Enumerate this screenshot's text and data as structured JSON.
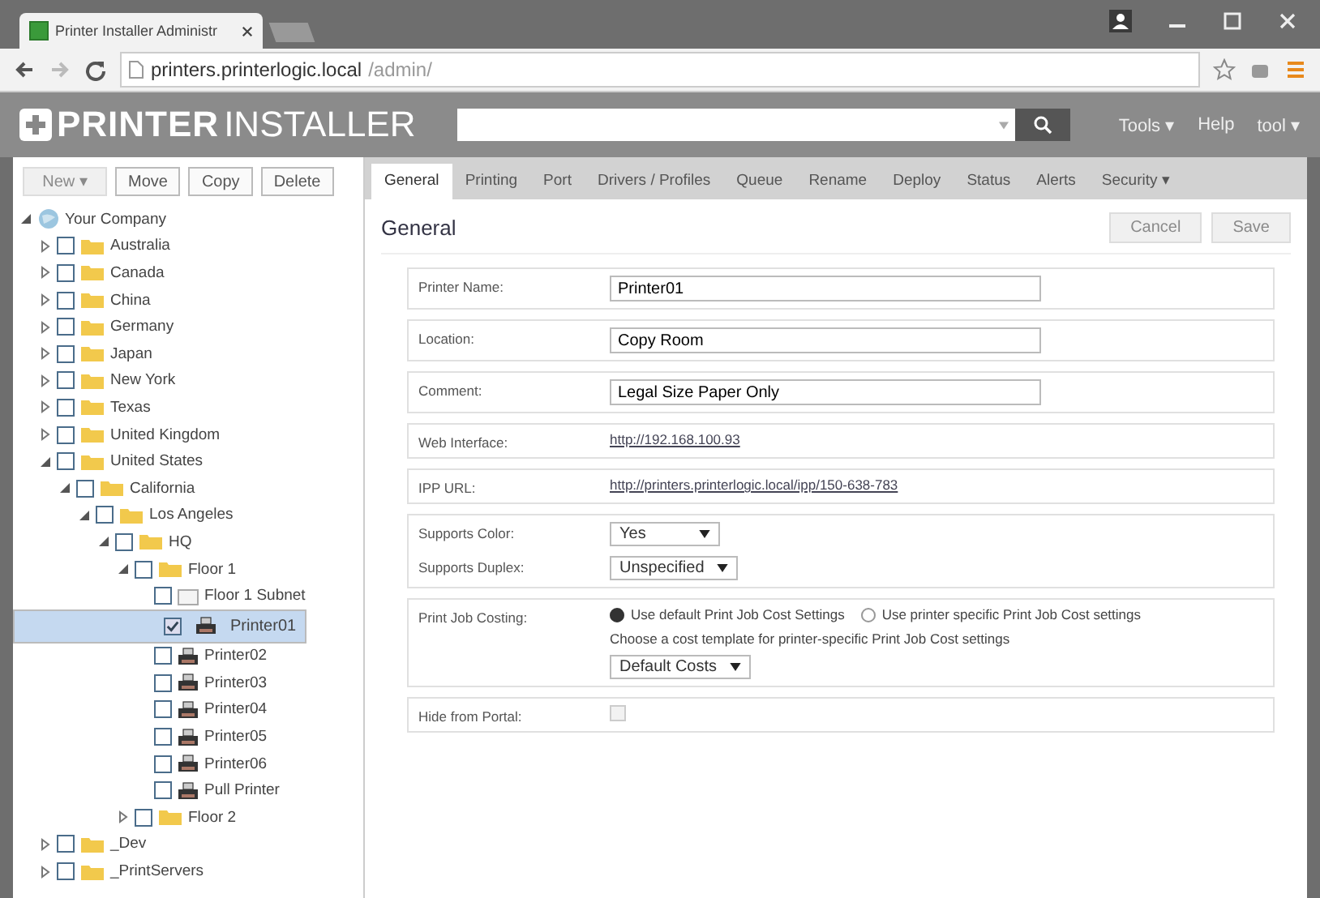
{
  "browser": {
    "tab_title": "Printer Installer Administr",
    "address_host": "printers.printerlogic.local",
    "address_path": "/admin/"
  },
  "header": {
    "logo_bold": "PRINTER",
    "logo_light": "INSTALLER",
    "menu": [
      "Tools ▾",
      "Help",
      "tool ▾"
    ]
  },
  "toolbar": [
    {
      "label": "New ▾",
      "disabled": true
    },
    {
      "label": "Move",
      "disabled": false
    },
    {
      "label": "Copy",
      "disabled": false
    },
    {
      "label": "Delete",
      "disabled": false
    }
  ],
  "tree": [
    {
      "label": "Your Company",
      "kind": "root",
      "expanded": true,
      "selected": false,
      "children": [
        {
          "label": "Australia",
          "kind": "folder",
          "checked": false,
          "expanded": false,
          "selected": false
        },
        {
          "label": "Canada",
          "kind": "folder",
          "checked": false,
          "expanded": false,
          "selected": false
        },
        {
          "label": "China",
          "kind": "folder",
          "checked": false,
          "expanded": false,
          "selected": false
        },
        {
          "label": "Germany",
          "kind": "folder",
          "checked": false,
          "expanded": false,
          "selected": false
        },
        {
          "label": "Japan",
          "kind": "folder",
          "checked": false,
          "expanded": false,
          "selected": false
        },
        {
          "label": "New York",
          "kind": "folder",
          "checked": false,
          "expanded": false,
          "selected": false
        },
        {
          "label": "Texas",
          "kind": "folder",
          "checked": false,
          "expanded": false,
          "selected": false
        },
        {
          "label": "United Kingdom",
          "kind": "folder",
          "checked": false,
          "expanded": false,
          "selected": false
        },
        {
          "label": "United States",
          "kind": "folder",
          "checked": false,
          "expanded": true,
          "selected": false,
          "children": [
            {
              "label": "California",
              "kind": "folder",
              "checked": false,
              "expanded": true,
              "selected": false,
              "children": [
                {
                  "label": "Los Angeles",
                  "kind": "folder",
                  "checked": false,
                  "expanded": true,
                  "selected": false,
                  "children": [
                    {
                      "label": "HQ",
                      "kind": "folder",
                      "checked": false,
                      "expanded": true,
                      "selected": false,
                      "children": [
                        {
                          "label": "Floor 1",
                          "kind": "folder",
                          "checked": false,
                          "expanded": true,
                          "selected": false,
                          "children": [
                            {
                              "label": "Floor 1 Subnet",
                              "kind": "subnet",
                              "checked": false,
                              "selected": false
                            },
                            {
                              "label": "Printer01",
                              "kind": "printer",
                              "checked": true,
                              "selected": true
                            },
                            {
                              "label": "Printer02",
                              "kind": "printer",
                              "checked": false,
                              "selected": false
                            },
                            {
                              "label": "Printer03",
                              "kind": "printer",
                              "checked": false,
                              "selected": false
                            },
                            {
                              "label": "Printer04",
                              "kind": "printer",
                              "checked": false,
                              "selected": false
                            },
                            {
                              "label": "Printer05",
                              "kind": "printer",
                              "checked": false,
                              "selected": false
                            },
                            {
                              "label": "Printer06",
                              "kind": "printer",
                              "checked": false,
                              "selected": false
                            },
                            {
                              "label": "Pull Printer",
                              "kind": "printer",
                              "checked": false,
                              "selected": false
                            }
                          ]
                        },
                        {
                          "label": "Floor 2",
                          "kind": "folder",
                          "checked": false,
                          "expanded": false,
                          "selected": false
                        }
                      ]
                    }
                  ]
                }
              ]
            }
          ]
        },
        {
          "label": "_Dev",
          "kind": "folder",
          "checked": false,
          "expanded": false,
          "selected": false
        },
        {
          "label": "_PrintServers",
          "kind": "folder",
          "checked": false,
          "expanded": false,
          "selected": false
        }
      ]
    }
  ],
  "tabs": [
    {
      "label": "General",
      "selected": true
    },
    {
      "label": "Printing",
      "selected": false
    },
    {
      "label": "Port",
      "selected": false
    },
    {
      "label": "Drivers / Profiles",
      "selected": false
    },
    {
      "label": "Queue",
      "selected": false
    },
    {
      "label": "Rename",
      "selected": false
    },
    {
      "label": "Deploy",
      "selected": false
    },
    {
      "label": "Status",
      "selected": false
    },
    {
      "label": "Alerts",
      "selected": false
    },
    {
      "label": "Security ▾",
      "selected": false
    }
  ],
  "section": {
    "title": "General",
    "buttons": [
      {
        "label": "Cancel",
        "disabled": true
      },
      {
        "label": "Save",
        "disabled": true
      }
    ]
  },
  "form": [
    {
      "rows": [
        {
          "label": "Printer Name:",
          "kind": "text",
          "value": "Printer01"
        }
      ]
    },
    {
      "rows": [
        {
          "label": "Location:",
          "kind": "text",
          "value": "Copy Room"
        }
      ]
    },
    {
      "rows": [
        {
          "label": "Comment:",
          "kind": "text",
          "value": "Legal Size Paper Only"
        }
      ]
    },
    {
      "rows": [
        {
          "label": "Web Interface:",
          "kind": "link",
          "value": "http://192.168.100.93"
        }
      ]
    },
    {
      "rows": [
        {
          "label": "IPP URL:",
          "kind": "link",
          "value": "http://printers.printerlogic.local/ipp/150-638-783"
        }
      ]
    },
    {
      "rows": [
        {
          "label": "Supports Color:",
          "kind": "select",
          "value": "Yes"
        },
        {
          "label": "Supports Duplex:",
          "kind": "select",
          "value": "Unspecified"
        }
      ]
    },
    {
      "rows": [
        {
          "label": "Print Job Costing:",
          "kind": "costing",
          "options": [
            {
              "label": "Use default Print Job Cost Settings",
              "selected": true
            },
            {
              "label": "Use printer specific Print Job Cost settings",
              "selected": false
            }
          ],
          "hint": "Choose a cost template for printer-specific Print Job Cost settings",
          "value": "Default Costs"
        }
      ]
    },
    {
      "rows": [
        {
          "label": "Hide from Portal:",
          "kind": "checkbox",
          "checked": false,
          "disabled": true
        }
      ]
    }
  ]
}
